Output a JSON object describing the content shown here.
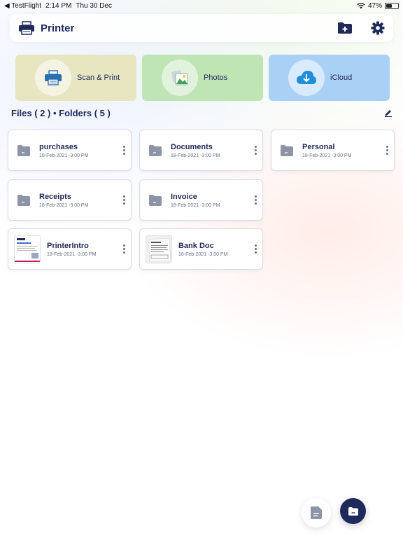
{
  "status_bar": {
    "back_app": "◀ TestFlight",
    "time": "2:14 PM",
    "date": "Thu 30 Dec",
    "battery": "47%",
    "battery_level": 0.47
  },
  "header": {
    "title": "Printer"
  },
  "tiles": [
    {
      "label": "Scan & Print",
      "icon": "printer-icon",
      "color": "#e8e6c0"
    },
    {
      "label": "Photos",
      "icon": "photos-icon",
      "color": "#bfe5b4"
    },
    {
      "label": "iCloud",
      "icon": "icloud-download-icon",
      "color": "#a9d0f5"
    }
  ],
  "section": {
    "title": "Files ( 2 ) • Folders ( 5 )"
  },
  "items": [
    {
      "name": "purchases",
      "date": "18-Feb-2021 -3:00 PM",
      "kind": "folder"
    },
    {
      "name": "Documents",
      "date": "18-Feb-2021 -3:00 PM",
      "kind": "folder"
    },
    {
      "name": "Personal",
      "date": "18-Feb-2021 -3:00 PM",
      "kind": "folder"
    },
    {
      "name": "Receipts",
      "date": "18-Feb-2021 -3:00 PM",
      "kind": "folder"
    },
    {
      "name": "Invoice",
      "date": "18-Feb-2021 -3:00 PM",
      "kind": "folder"
    },
    {
      "name": "PrinterIntro",
      "date": "18-Feb-2021 -3:00 PM",
      "kind": "file"
    },
    {
      "name": "Bank Doc",
      "date": "18-Feb-2021 -3:00 PM",
      "kind": "file"
    }
  ],
  "colors": {
    "primary": "#1f2a5a",
    "folder": "#8e94a8"
  }
}
